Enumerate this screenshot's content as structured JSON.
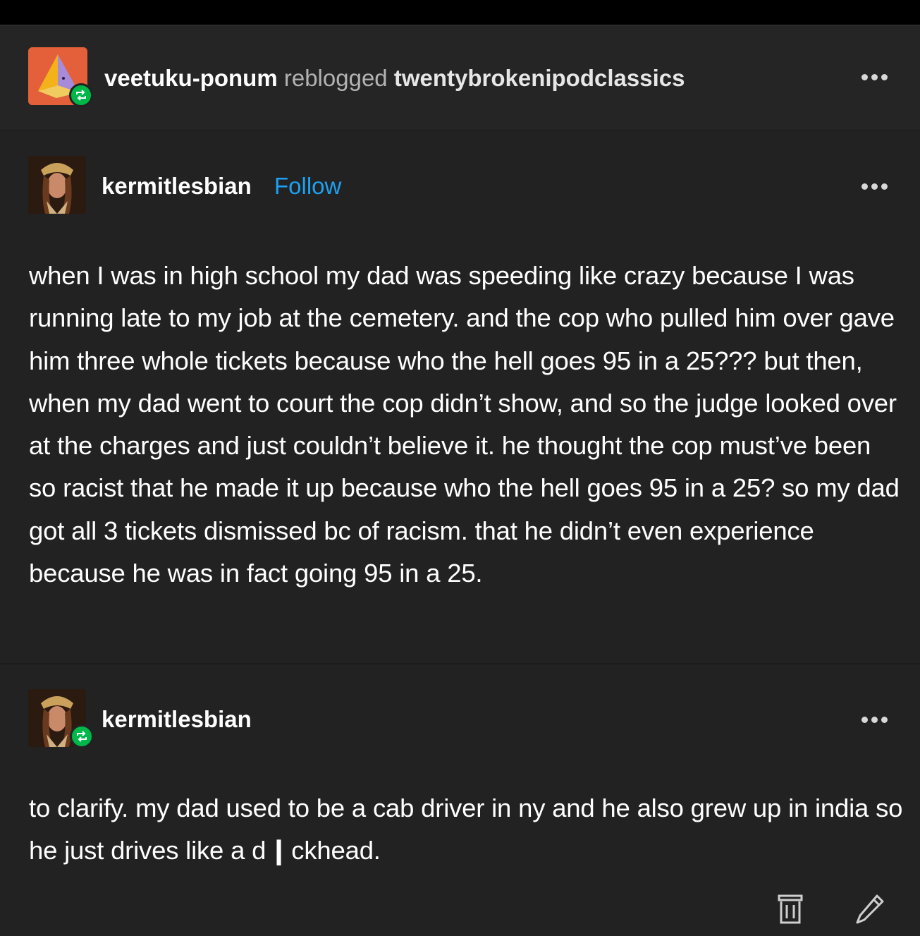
{
  "header": {
    "reblogger": "veetuku-ponum",
    "verb": "reblogged",
    "source": "twentybrokenipodclassics"
  },
  "post1": {
    "username": "kermitlesbian",
    "follow_label": "Follow",
    "body": "when I was in high school my dad was speeding like crazy because I was running late to my job at the cemetery. and the cop who pulled him over gave him three whole tickets because who the hell goes 95 in a 25??? but then, when my dad went to court the cop didn’t show, and so the judge looked over at the charges and just couldn’t believe it. he thought the cop must’ve been so racist that he made it up because who the hell goes 95 in a 25? so my dad got all 3 tickets dismissed bc of racism. that he didn’t even experience because he was in fact going 95 in a 25."
  },
  "post2": {
    "username": "kermitlesbian",
    "body": "to clarify. my dad used to be a cab driver in ny and he also grew up in india so he just drives like a d ❙ ckhead."
  },
  "icons": {
    "more": "more-dots-icon",
    "reblog": "reblog-icon",
    "delete": "trash-icon",
    "edit": "pencil-icon"
  },
  "colors": {
    "background": "#222222",
    "accent_follow": "#1da1f2",
    "reblog_green": "#00b84a",
    "avatar_orange": "#e4603a"
  }
}
